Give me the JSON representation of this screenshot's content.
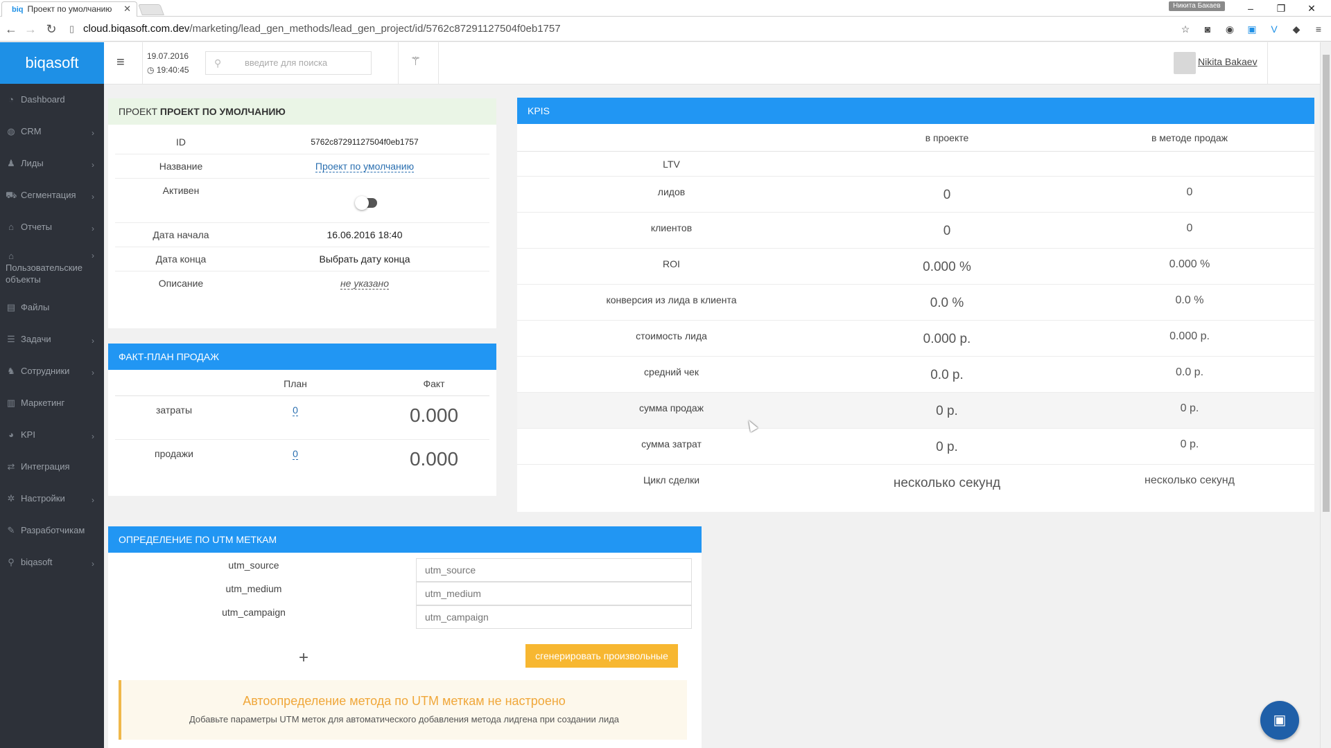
{
  "browser": {
    "tab_title": "Проект по умолчанию",
    "tab_favicon": "biq",
    "user_badge": "Никита Бакаев",
    "url_host": "cloud.biqasoft.com.dev",
    "url_path": "/marketing/lead_gen_methods/lead_gen_project/id/5762c87291127504f0eb1757"
  },
  "sidebar": {
    "logo": "biqasoft",
    "items": [
      {
        "label": "Dashboard",
        "icon": "dashboard-icon",
        "chevron": false
      },
      {
        "label": "CRM",
        "icon": "crm-icon",
        "chevron": true
      },
      {
        "label": "Лиды",
        "icon": "users-icon",
        "chevron": true
      },
      {
        "label": "Сегментация",
        "icon": "cart-icon",
        "chevron": true
      },
      {
        "label": "Отчеты",
        "icon": "bank-icon",
        "chevron": true
      },
      {
        "label": "Пользовательские объекты",
        "icon": "bank-icon",
        "chevron": true
      },
      {
        "label": "Файлы",
        "icon": "file-icon",
        "chevron": false
      },
      {
        "label": "Задачи",
        "icon": "tasks-icon",
        "chevron": true
      },
      {
        "label": "Сотрудники",
        "icon": "group-icon",
        "chevron": true
      },
      {
        "label": "Маркетинг",
        "icon": "bar-chart-icon",
        "chevron": false
      },
      {
        "label": "KPI",
        "icon": "gauge-icon",
        "chevron": true
      },
      {
        "label": "Интеграция",
        "icon": "exchange-icon",
        "chevron": false
      },
      {
        "label": "Настройки",
        "icon": "gear-icon",
        "chevron": true
      },
      {
        "label": "Разработчикам",
        "icon": "wrench-icon",
        "chevron": false
      },
      {
        "label": "biqasoft",
        "icon": "pin-icon",
        "chevron": true
      }
    ]
  },
  "header": {
    "date": "19.07.2016",
    "time": "19:40:45",
    "search_placeholder": "введите для поиска",
    "user_name": "Nikita Bakaev"
  },
  "project": {
    "title_prefix": "Проект",
    "title_name": "Проект по умолчанию",
    "rows": [
      {
        "key": "ID",
        "value": "5762c87291127504f0eb1757"
      },
      {
        "key": "Название",
        "value": "Проект по умолчанию"
      },
      {
        "key": "Активен",
        "value": ""
      },
      {
        "key": "Дата начала",
        "value": "16.06.2016 18:40"
      },
      {
        "key": "Дата конца",
        "value": "Выбрать дату конца"
      },
      {
        "key": "Описание",
        "value": "не указано"
      }
    ],
    "active": false
  },
  "factplan": {
    "title": "Факт-план продаж",
    "col_plan": "План",
    "col_fact": "Факт",
    "rows": [
      {
        "label": "затраты",
        "plan": "0",
        "fact": "0.000"
      },
      {
        "label": "продажи",
        "plan": "0",
        "fact": "0.000"
      }
    ]
  },
  "kpis": {
    "title": "KPIs",
    "col_project": "в проекте",
    "col_method": "в методе продаж",
    "rows": [
      {
        "label": "LTV",
        "project": "",
        "method": ""
      },
      {
        "label": "лидов",
        "project": "0",
        "method": "0"
      },
      {
        "label": "клиентов",
        "project": "0",
        "method": "0"
      },
      {
        "label": "ROI",
        "project": "0.000 %",
        "method": "0.000 %"
      },
      {
        "label": "конверсия из лида в клиента",
        "project": "0.0 %",
        "method": "0.0 %"
      },
      {
        "label": "стоимость лида",
        "project": "0.000 р.",
        "method": "0.000 р."
      },
      {
        "label": "средний чек",
        "project": "0.0 р.",
        "method": "0.0 р."
      },
      {
        "label": "сумма продаж",
        "project": "0 р.",
        "method": "0 р."
      },
      {
        "label": "сумма затрат",
        "project": "0 р.",
        "method": "0 р."
      },
      {
        "label": "Цикл сделки",
        "project": "несколько секунд",
        "method": "несколько секунд"
      }
    ]
  },
  "utm": {
    "title": "Определение по UTM меткам",
    "rows": [
      {
        "label": "utm_source",
        "placeholder": "utm_source"
      },
      {
        "label": "utm_medium",
        "placeholder": "utm_medium"
      },
      {
        "label": "utm_campaign",
        "placeholder": "utm_campaign"
      }
    ],
    "add_symbol": "+",
    "generate_label": "сгенерировать произвольные",
    "alert_title": "Автоопределение метода по UTM меткам не настроено",
    "alert_text": "Добавьте параметры UTM меток для автоматического добавления метода лидгена при создании лида"
  },
  "colors": {
    "primary": "#2196f3",
    "sidebar": "#2d3139",
    "warning": "#f7b731",
    "save_button": "#1f5fa8"
  }
}
